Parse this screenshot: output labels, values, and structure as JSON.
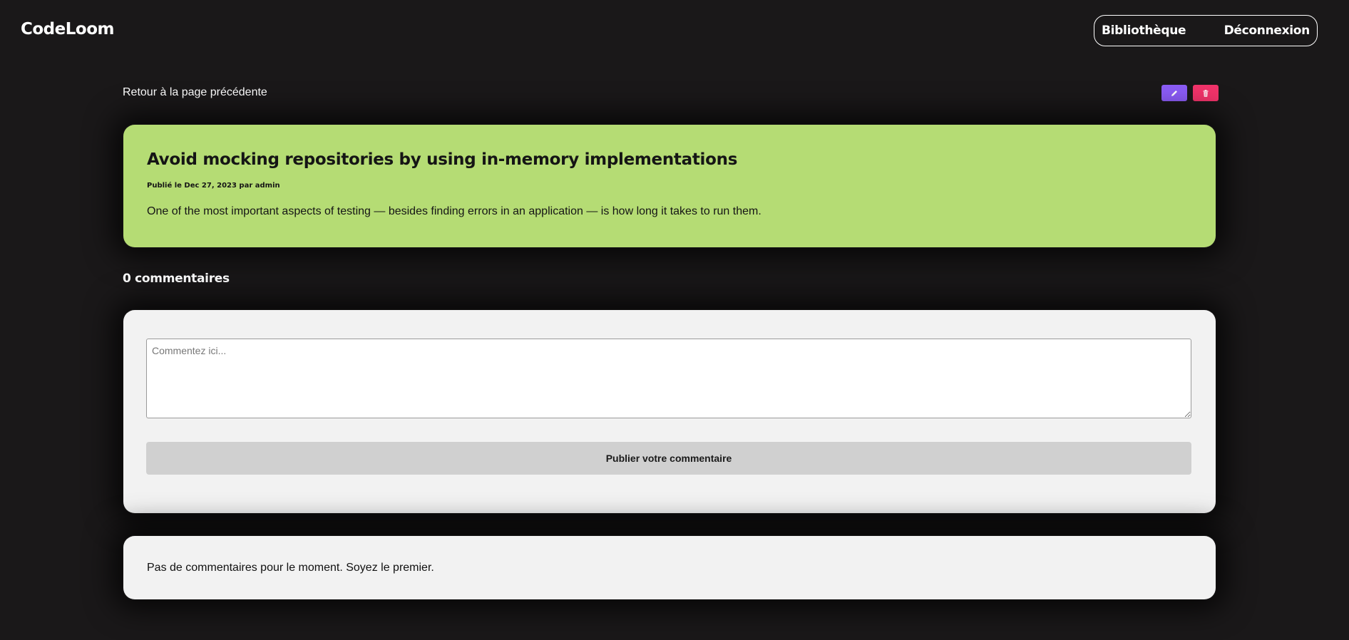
{
  "header": {
    "logo": "CodeLoom",
    "nav": {
      "library_label": "Bibliothèque",
      "logout_label": "Déconnexion"
    }
  },
  "toolbar": {
    "back_label": "Retour à la page précédente",
    "edit_icon": "pencil-icon",
    "delete_icon": "trash-icon",
    "edit_color": "#8b5cf6",
    "delete_color": "#f1336a"
  },
  "post": {
    "title": "Avoid mocking repositories by using in-memory implementations",
    "meta": "Publié le Dec 27, 2023 par admin",
    "excerpt": "One of the most important aspects of testing — besides finding errors in an application — is how long it takes to run them.",
    "card_color": "#b5dc74"
  },
  "comments": {
    "count_label": "0 commentaires",
    "placeholder": "Commentez ici...",
    "submit_label": "Publier votre commentaire",
    "empty_message": "Pas de commentaires pour le moment. Soyez le premier."
  }
}
